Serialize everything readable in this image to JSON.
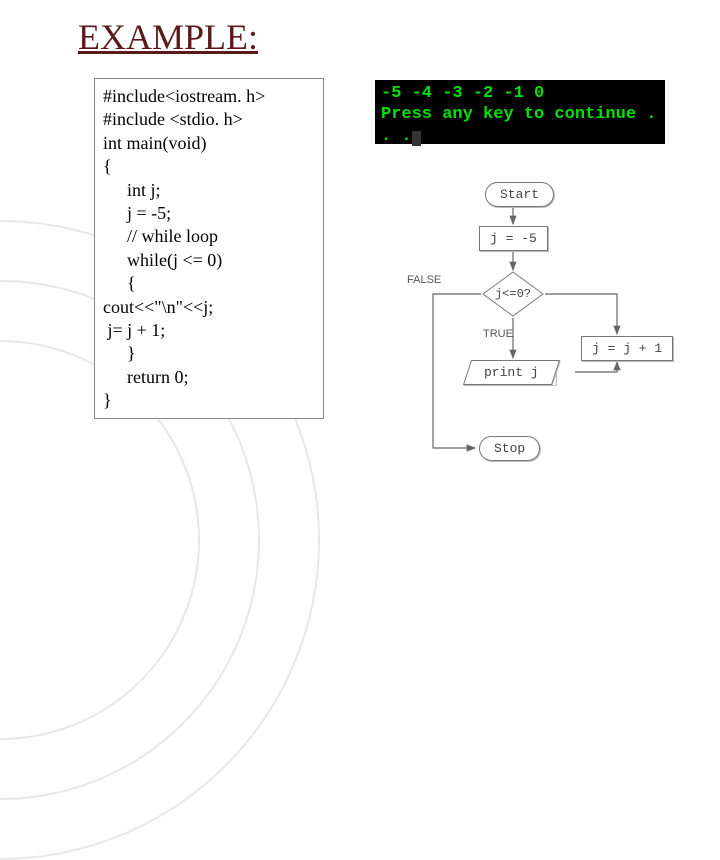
{
  "title": "EXAMPLE:",
  "code": {
    "l1": "#include<iostream. h>",
    "l2": "#include <stdio. h>",
    "l3": "int main(void)",
    "l4": "{",
    "l5": "int j;",
    "l6": "j = -5;",
    "l7": "// while loop",
    "l8": "while(j <= 0)",
    "l9": "{",
    "l10": "cout<<\"\\n\"<<j;",
    "l11": " j= j + 1;",
    "l12": "}",
    "l13": "return 0;",
    "l14": "}"
  },
  "console": {
    "line1": "-5 -4 -3 -2 -1 0",
    "line2": "Press any key to continue . . ."
  },
  "flow": {
    "start": "Start",
    "init": "j = -5",
    "cond": "j<=0?",
    "print": "print j",
    "inc": "j = j + 1",
    "stop": "Stop",
    "falseLabel": "FALSE",
    "trueLabel": "TRUE"
  },
  "chart_data": {
    "type": "flowchart",
    "nodes": [
      {
        "id": "start",
        "shape": "terminator",
        "label": "Start"
      },
      {
        "id": "init",
        "shape": "process",
        "label": "j = -5"
      },
      {
        "id": "cond",
        "shape": "decision",
        "label": "j<=0?"
      },
      {
        "id": "print",
        "shape": "io",
        "label": "print j"
      },
      {
        "id": "inc",
        "shape": "process",
        "label": "j = j + 1"
      },
      {
        "id": "stop",
        "shape": "terminator",
        "label": "Stop"
      }
    ],
    "edges": [
      {
        "from": "start",
        "to": "init"
      },
      {
        "from": "init",
        "to": "cond"
      },
      {
        "from": "cond",
        "to": "print",
        "label": "TRUE"
      },
      {
        "from": "print",
        "to": "inc"
      },
      {
        "from": "inc",
        "to": "cond"
      },
      {
        "from": "cond",
        "to": "stop",
        "label": "FALSE"
      }
    ]
  }
}
